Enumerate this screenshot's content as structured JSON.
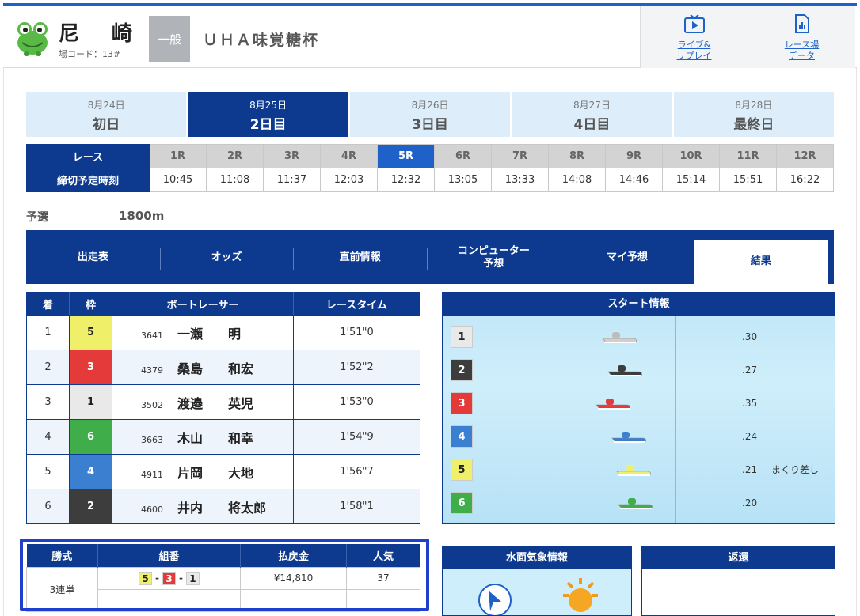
{
  "header": {
    "venue": "尼 崎",
    "venue_code": "場コード：13#",
    "grade": "一般",
    "race_name": "ＵＨＡ味覚糖杯",
    "live_label_1": "ライブ&",
    "live_label_2": "リプレイ",
    "data_label_1": "レース場",
    "data_label_2": "データ"
  },
  "days": [
    {
      "date": "8月24日",
      "name": "初日"
    },
    {
      "date": "8月25日",
      "name": "2日目",
      "active": true
    },
    {
      "date": "8月26日",
      "name": "3日目"
    },
    {
      "date": "8月27日",
      "name": "4日目"
    },
    {
      "date": "8月28日",
      "name": "最終日"
    }
  ],
  "races": {
    "race_label": "レース",
    "deadline_label": "締切予定時刻",
    "numbers": [
      "1R",
      "2R",
      "3R",
      "4R",
      "5R",
      "6R",
      "7R",
      "8R",
      "9R",
      "10R",
      "11R",
      "12R"
    ],
    "times": [
      "10:45",
      "11:08",
      "11:37",
      "12:03",
      "12:32",
      "13:05",
      "13:33",
      "14:08",
      "14:46",
      "15:14",
      "15:51",
      "16:22"
    ],
    "current": "5R"
  },
  "race_info": {
    "class": "予選",
    "distance": "1800m"
  },
  "tabs": [
    "出走表",
    "オッズ",
    "直前情報",
    "コンピューター予想",
    "マイ予想",
    "結果"
  ],
  "tabs_active": "結果",
  "results": {
    "headers": [
      "着",
      "枠",
      "ボートレーサー",
      "レースタイム"
    ],
    "rows": [
      {
        "rank": "1",
        "waku": "5",
        "reg": "3641",
        "name": "一瀬　　明",
        "time": "1'51\"0"
      },
      {
        "rank": "2",
        "waku": "3",
        "reg": "4379",
        "name": "桑島　　和宏",
        "time": "1'52\"2"
      },
      {
        "rank": "3",
        "waku": "1",
        "reg": "3502",
        "name": "渡邉　　英児",
        "time": "1'53\"0"
      },
      {
        "rank": "4",
        "waku": "6",
        "reg": "3663",
        "name": "木山　　和幸",
        "time": "1'54\"9"
      },
      {
        "rank": "5",
        "waku": "4",
        "reg": "4911",
        "name": "片岡　　大地",
        "time": "1'56\"7"
      },
      {
        "rank": "6",
        "waku": "2",
        "reg": "4600",
        "name": "井内　　将太郎",
        "time": "1'58\"1"
      }
    ]
  },
  "start_info": {
    "title": "スタート情報",
    "rows": [
      {
        "waku": "1",
        "st": ".30",
        "kimarite": ""
      },
      {
        "waku": "2",
        "st": ".27",
        "kimarite": ""
      },
      {
        "waku": "3",
        "st": ".35",
        "kimarite": ""
      },
      {
        "waku": "4",
        "st": ".24",
        "kimarite": ""
      },
      {
        "waku": "5",
        "st": ".21",
        "kimarite": "まくり差し"
      },
      {
        "waku": "6",
        "st": ".20",
        "kimarite": ""
      }
    ]
  },
  "payout": {
    "headers": [
      "勝式",
      "組番",
      "払戻金",
      "人気"
    ],
    "type": "3連単",
    "combo": [
      "5",
      "3",
      "1"
    ],
    "amount": "¥14,810",
    "popularity": "37"
  },
  "weather": {
    "title": "水面気象情報"
  },
  "refund": {
    "title": "返還"
  },
  "colors": {
    "waku1": "#e9e9e9",
    "waku2": "#3d3d3d",
    "waku3": "#e43a3a",
    "waku4": "#3a7fd0",
    "waku5": "#f0ef6a",
    "waku6": "#3fae4a",
    "navy": "#0d3a8e",
    "accent": "#1e62c9"
  }
}
